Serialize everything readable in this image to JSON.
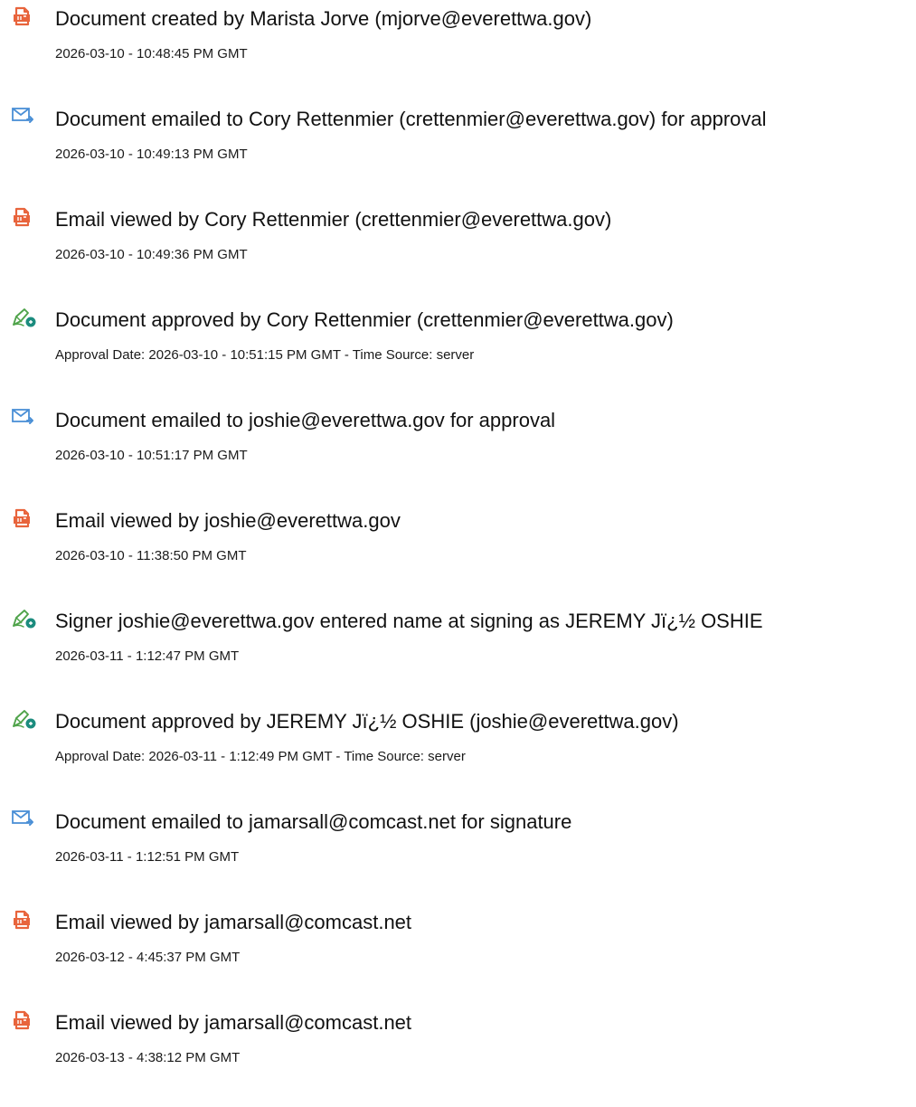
{
  "entries": [
    {
      "icon": "document-created-icon",
      "text": "Document created by Marista Jorve (mjorve@everettwa.gov)",
      "time": "2026-03-10 - 10:48:45 PM GMT"
    },
    {
      "icon": "email-sent-icon",
      "text": "Document emailed to Cory Rettenmier (crettenmier@everettwa.gov) for approval",
      "time": "2026-03-10 - 10:49:13 PM GMT"
    },
    {
      "icon": "document-viewed-icon",
      "text": "Email viewed by Cory Rettenmier (crettenmier@everettwa.gov)",
      "time": "2026-03-10 - 10:49:36 PM GMT"
    },
    {
      "icon": "pen-approved-icon",
      "text": "Document approved by Cory Rettenmier (crettenmier@everettwa.gov)",
      "time": "Approval Date: 2026-03-10 - 10:51:15 PM GMT - Time Source: server"
    },
    {
      "icon": "email-sent-icon",
      "text": "Document emailed to joshie@everettwa.gov for approval",
      "time": "2026-03-10 - 10:51:17 PM GMT"
    },
    {
      "icon": "document-viewed-icon",
      "text": "Email viewed by joshie@everettwa.gov",
      "time": "2026-03-10 - 11:38:50 PM GMT"
    },
    {
      "icon": "pen-approved-icon",
      "text": "Signer joshie@everettwa.gov entered name at signing as JEREMY Jï¿½ OSHIE",
      "time": "2026-03-11 - 1:12:47 PM GMT"
    },
    {
      "icon": "pen-approved-icon",
      "text": "Document approved by JEREMY Jï¿½ OSHIE (joshie@everettwa.gov)",
      "time": "Approval Date: 2026-03-11 - 1:12:49 PM GMT - Time Source: server"
    },
    {
      "icon": "email-sent-icon",
      "text": "Document emailed to jamarsall@comcast.net for signature",
      "time": "2026-03-11 - 1:12:51 PM GMT"
    },
    {
      "icon": "document-viewed-icon",
      "text": "Email viewed by jamarsall@comcast.net",
      "time": "2026-03-12 - 4:45:37 PM GMT"
    },
    {
      "icon": "document-viewed-icon",
      "text": "Email viewed by jamarsall@comcast.net",
      "time": "2026-03-13 - 4:38:12 PM GMT"
    }
  ],
  "colors": {
    "document_icon": "#E8643C",
    "email_icon": "#4A8FD6",
    "pen_icon": "#4FA34A",
    "badge": "#1C8C7E"
  }
}
